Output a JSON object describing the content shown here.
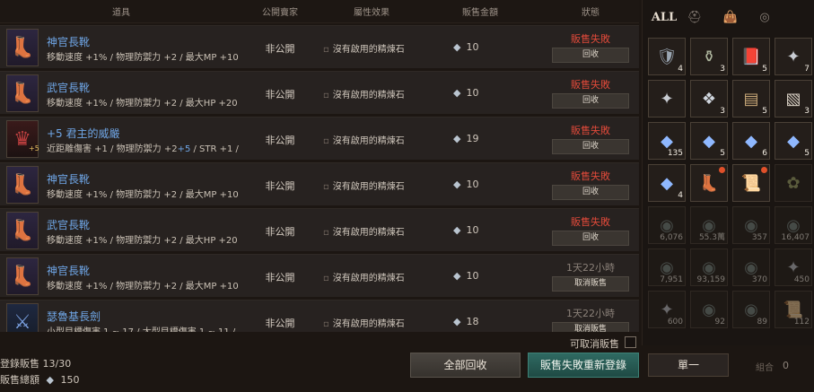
{
  "header": {
    "col_item": "道具",
    "col_public": "公開賣家",
    "col_attr": "屬性效果",
    "col_price": "販售金額",
    "col_status": "狀態"
  },
  "rows": [
    {
      "name": "神官長靴",
      "desc": "移動速度 +1% / 物理防禦力 +2 / 最大MP +10",
      "public": "非公開",
      "attr": "沒有啟用的精煉石",
      "price": "10",
      "status": "販售失敗",
      "button": "回收",
      "thumb": "purple",
      "enh": ""
    },
    {
      "name": "武官長靴",
      "desc": "移動速度 +1% / 物理防禦力 +2 / 最大HP +20",
      "public": "非公開",
      "attr": "沒有啟用的精煉石",
      "price": "10",
      "status": "販售失敗",
      "button": "回收",
      "thumb": "purple",
      "enh": ""
    },
    {
      "name": "+5 君主的威嚴",
      "desc_pre": "近距離傷害 +1 / 物理防禦力 +2",
      "desc_hl": "+5",
      "desc_post": " / STR +1 /",
      "public": "非公開",
      "attr": "沒有啟用的精煉石",
      "price": "19",
      "status": "販售失敗",
      "button": "回收",
      "thumb": "red",
      "enh": "+5"
    },
    {
      "name": "神官長靴",
      "desc": "移動速度 +1% / 物理防禦力 +2 / 最大MP +10",
      "public": "非公開",
      "attr": "沒有啟用的精煉石",
      "price": "10",
      "status": "販售失敗",
      "button": "回收",
      "thumb": "purple",
      "enh": ""
    },
    {
      "name": "武官長靴",
      "desc": "移動速度 +1% / 物理防禦力 +2 / 最大HP +20",
      "public": "非公開",
      "attr": "沒有啟用的精煉石",
      "price": "10",
      "status": "販售失敗",
      "button": "回收",
      "thumb": "purple",
      "enh": ""
    },
    {
      "name": "神官長靴",
      "desc": "移動速度 +1% / 物理防禦力 +2 / 最大MP +10",
      "public": "非公開",
      "attr": "沒有啟用的精煉石",
      "price": "10",
      "status": "1天22小時",
      "button": "取消販售",
      "thumb": "purple",
      "enh": ""
    },
    {
      "name": "瑟魯基長劍",
      "desc": "小型目標傷害 1 ~ 17 / 大型目標傷害 1 ~ 11 /",
      "public": "非公開",
      "attr": "沒有啟用的精煉石",
      "price": "18",
      "status": "1天22小時",
      "button": "取消販售",
      "thumb": "blue",
      "enh": ""
    }
  ],
  "footer": {
    "cancellable_label": "可取消販售",
    "registered": "登錄販售 13/30",
    "sales_total_label": "販售總額",
    "sales_total_value": "150",
    "retrieve_all": "全部回收",
    "relist_failed": "販售失敗重新登錄",
    "single": "單一",
    "group": "組合",
    "group_count": "0"
  },
  "inventory": {
    "tabs": [
      "ALL",
      "helmet-icon",
      "bag-icon",
      "orb-icon"
    ],
    "slots": [
      {
        "icon": "armor-icon",
        "count": "4"
      },
      {
        "icon": "bottle-icon",
        "count": "3"
      },
      {
        "icon": "book-icon",
        "count": "5"
      },
      {
        "icon": "ore-icon",
        "count": "7"
      },
      {
        "icon": "ore-icon",
        "count": ""
      },
      {
        "icon": "crystal-icon",
        "count": "3"
      },
      {
        "icon": "wood-icon",
        "count": "5"
      },
      {
        "icon": "cloth-icon",
        "count": "3"
      },
      {
        "icon": "gem-icon",
        "count": "135"
      },
      {
        "icon": "gem-icon",
        "count": "5"
      },
      {
        "icon": "gem-icon",
        "count": "6"
      },
      {
        "icon": "gem-icon",
        "count": "5"
      },
      {
        "icon": "gem-icon",
        "count": "4"
      },
      {
        "icon": "boots-icon",
        "count": ""
      },
      {
        "icon": "scroll-icon",
        "count": ""
      },
      {
        "icon": "herb-icon",
        "count": ""
      },
      {
        "icon": "coin-icon",
        "count": "6,076"
      },
      {
        "icon": "coin-icon",
        "count": "55.3萬"
      },
      {
        "icon": "coin-icon",
        "count": "357"
      },
      {
        "icon": "coin-icon",
        "count": "16,407"
      },
      {
        "icon": "coin-icon",
        "count": "7,951"
      },
      {
        "icon": "coin-icon",
        "count": "93,159"
      },
      {
        "icon": "coin-icon",
        "count": "370"
      },
      {
        "icon": "ore-icon",
        "count": "450"
      },
      {
        "icon": "ore-icon",
        "count": "600"
      },
      {
        "icon": "coin-icon",
        "count": "92"
      },
      {
        "icon": "coin-icon",
        "count": "89"
      },
      {
        "icon": "scroll-icon",
        "count": "112"
      }
    ]
  }
}
